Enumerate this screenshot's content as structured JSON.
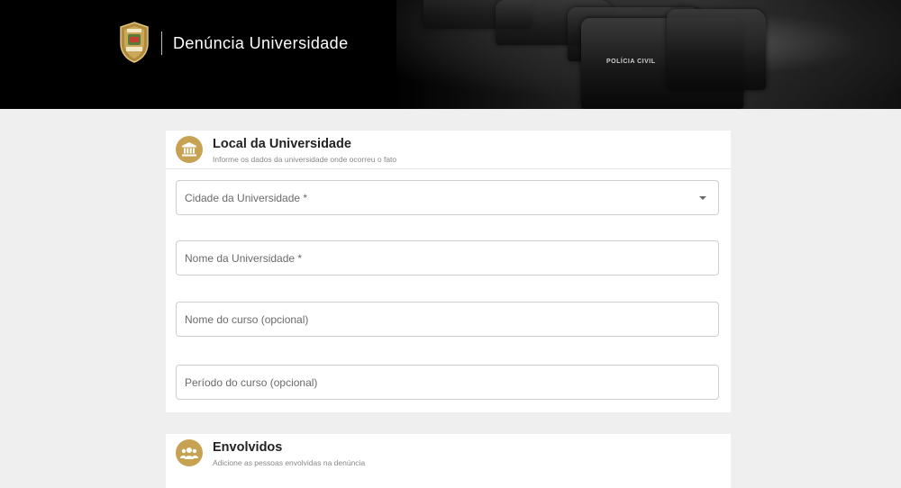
{
  "header": {
    "app_title": "Denúncia Universidade",
    "badge_icon": "policia-civil-badge-icon",
    "vehicle_text": "POLÍCIA CIVIL"
  },
  "sections": [
    {
      "icon": "university-building-icon",
      "title": "Local da Universidade",
      "subtitle": "Informe os dados da universidade onde ocorreu o fato",
      "fields": [
        {
          "label": "Cidade da Universidade *",
          "type": "select",
          "value": ""
        },
        {
          "label": "Nome da Universidade *",
          "type": "text",
          "value": ""
        },
        {
          "label": "Nome do curso (opcional)",
          "type": "text",
          "value": ""
        },
        {
          "label": "Período do curso (opcional)",
          "type": "text",
          "value": ""
        }
      ]
    },
    {
      "icon": "people-group-icon",
      "title": "Envolvidos",
      "subtitle": "Adicione as pessoas envolvidas na denúncia"
    }
  ],
  "colors": {
    "accent_gold": "#c7a253",
    "header_bg": "#000000",
    "page_bg": "#efefef"
  }
}
